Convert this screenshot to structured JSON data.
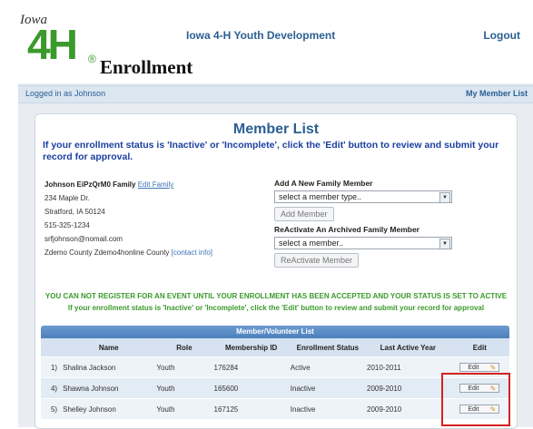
{
  "header": {
    "logo_top": "Iowa",
    "logo_main": "4H",
    "logo_clover": "®",
    "logo_sub": "Enrollment",
    "site_title": "Iowa 4-H Youth Development",
    "logout": "Logout"
  },
  "login_bar": {
    "logged_in": "Logged in as Johnson",
    "my_member_list": "My Member List"
  },
  "panel": {
    "title": "Member List",
    "instruction": "If your enrollment status is 'Inactive' or 'Incomplete', click the 'Edit' button to review and submit your record for approval.",
    "family": {
      "name": "Johnson EiPzQrM0 Family",
      "edit_family": "Edit Family",
      "address1": "234 Maple Dr.",
      "address2": "Stratford, IA 50124",
      "phone": "515-325-1234",
      "email": "srfjohnson@nomail.com",
      "county": "Zdemo County Zdemo4honline County",
      "contact_info": "[contact info]"
    },
    "add": {
      "label": "Add A New Family Member",
      "select_value": "select a member type..",
      "button": "Add Member"
    },
    "reactivate": {
      "label": "ReActivate An Archived Family Member",
      "select_value": "select a member..",
      "button": "ReActivate Member"
    },
    "warning1": "YOU CAN NOT REGISTER FOR AN EVENT UNTIL YOUR ENROLLMENT HAS BEEN ACCEPTED AND YOUR STATUS IS SET TO ACTIVE",
    "warning2": "If your enrollment status is 'Inactive' or 'Incomplete', click the 'Edit' button to review and submit your record for approval",
    "table": {
      "title": "Member/Volunteer List",
      "headers": [
        "Name",
        "Role",
        "Membership ID",
        "Enrollment Status",
        "Last Active Year",
        "Edit"
      ],
      "rows": [
        {
          "num": "1)",
          "name": "Shalina Jackson",
          "role": "Youth",
          "id": "176284",
          "status": "Active",
          "year": "2010-2011",
          "edit": "Edit"
        },
        {
          "num": "4)",
          "name": "Shawna Johnson",
          "role": "Youth",
          "id": "165600",
          "status": "Inactive",
          "year": "2009-2010",
          "edit": "Edit"
        },
        {
          "num": "5)",
          "name": "Shelley Johnson",
          "role": "Youth",
          "id": "167125",
          "status": "Inactive",
          "year": "2009-2010",
          "edit": "Edit"
        }
      ]
    }
  },
  "icons": {
    "select_arrow": "chevron-down-icon",
    "edit_pencil": "pencil-icon"
  },
  "colors": {
    "brand_blue": "#2b5f93",
    "brand_green": "#3a9a2b",
    "highlight_red": "#d62020"
  }
}
